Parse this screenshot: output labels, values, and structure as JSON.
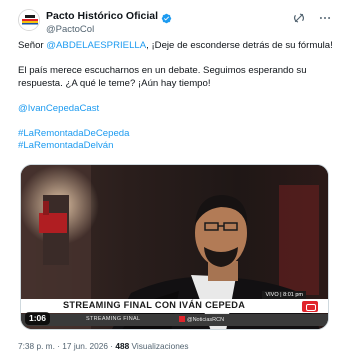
{
  "author": {
    "display_name": "Pacto Histórico Oficial",
    "handle": "@PactoCol",
    "verified": true,
    "verified_color": "#1d9bf0"
  },
  "tweet": {
    "line1_prefix": "Señor ",
    "line1_mention": "@ABDELAESPRIELLA",
    "line1_suffix": ", ¡Deje de esconderse detrás de su fórmula!",
    "line2": "El país merece escucharnos en un debate. Seguimos esperando su respuesta. ¿A qué le teme? ¡Aún hay tiempo!",
    "mention": "@IvanCepedaCast",
    "hashtag1": "#LaRemontadaDeCepeda",
    "hashtag2": "#LaRemontadaDelván",
    "link_color": "#1d9bf0"
  },
  "media": {
    "caption": "STREAMING FINAL CON IVÁN CEPEDA",
    "sub_label": "STREAMING FINAL",
    "sub_handle": "@NoticiasRCN",
    "live_tag": "VIVO | 8:01 pm",
    "duration": "1:06"
  },
  "meta": {
    "time": "7:38 p. m.",
    "date": "17 jun. 2026",
    "separator": "·",
    "views_count": "488",
    "views_label": "Visualizaciones"
  },
  "icons": {
    "grok": "grok-icon",
    "more": "more-icon",
    "verified": "verified-badge-icon"
  }
}
